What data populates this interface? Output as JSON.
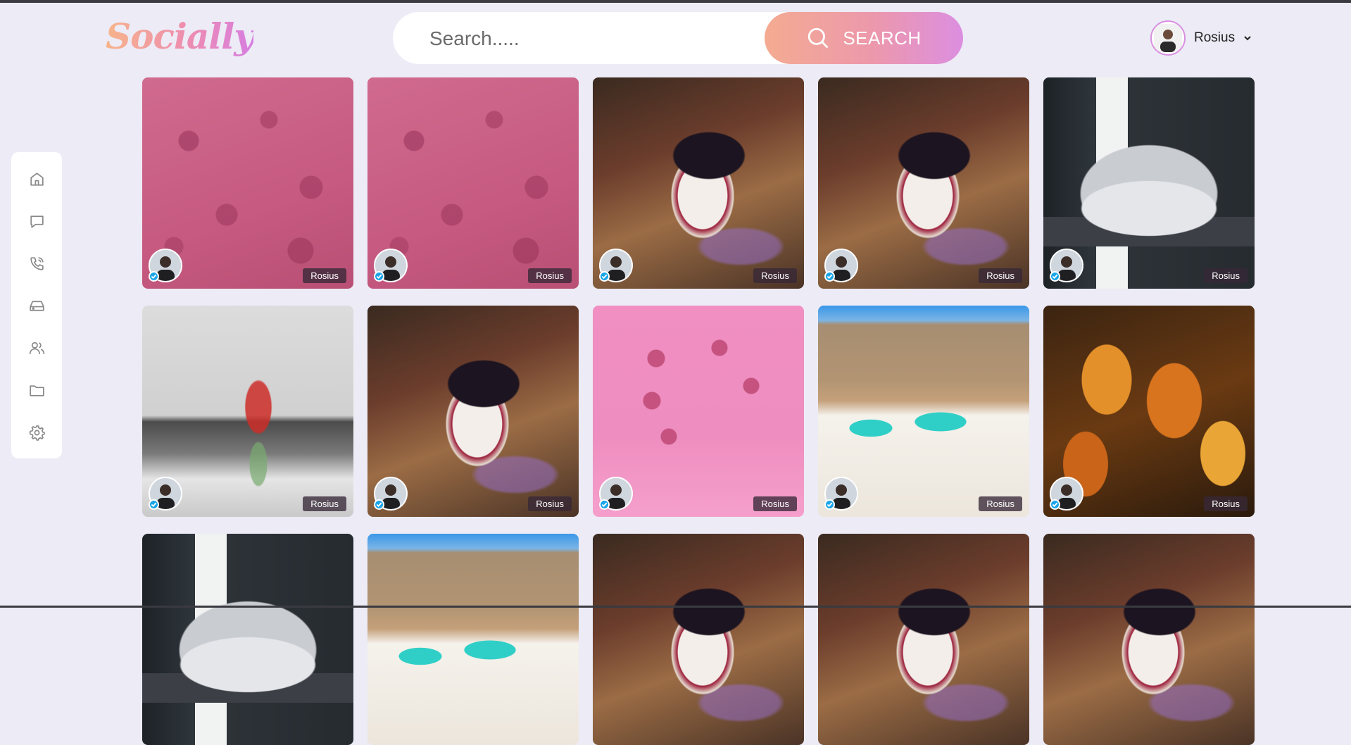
{
  "header": {
    "logo_text": "Socially",
    "search_placeholder": "Search.....",
    "search_button_label": "SEARCH"
  },
  "user": {
    "name": "Rosius"
  },
  "sidebar": {
    "items": [
      {
        "name": "home",
        "icon": "home-icon"
      },
      {
        "name": "messages",
        "icon": "chat-icon"
      },
      {
        "name": "calls",
        "icon": "phone-icon"
      },
      {
        "name": "storage",
        "icon": "drive-icon"
      },
      {
        "name": "people",
        "icon": "users-icon"
      },
      {
        "name": "files",
        "icon": "folder-icon"
      },
      {
        "name": "settings",
        "icon": "gear-icon"
      }
    ]
  },
  "posts": [
    {
      "image": "pink-abstract",
      "author": "Rosius"
    },
    {
      "image": "pink-abstract",
      "author": "Rosius"
    },
    {
      "image": "parfait",
      "author": "Rosius"
    },
    {
      "image": "parfait",
      "author": "Rosius"
    },
    {
      "image": "car",
      "author": "Rosius"
    },
    {
      "image": "kitchen",
      "author": "Rosius"
    },
    {
      "image": "parfait",
      "author": "Rosius"
    },
    {
      "image": "pink-hearts",
      "author": "Rosius"
    },
    {
      "image": "desert",
      "author": "Rosius"
    },
    {
      "image": "tulips",
      "author": "Rosius"
    },
    {
      "image": "car",
      "author": ""
    },
    {
      "image": "desert",
      "author": ""
    },
    {
      "image": "parfait",
      "author": ""
    },
    {
      "image": "parfait",
      "author": ""
    },
    {
      "image": "parfait",
      "author": ""
    }
  ],
  "colors": {
    "background": "#ecebf6",
    "accent_start": "#f4ab91",
    "accent_end": "#dc8ee0",
    "verified": "#1aa5e8"
  }
}
